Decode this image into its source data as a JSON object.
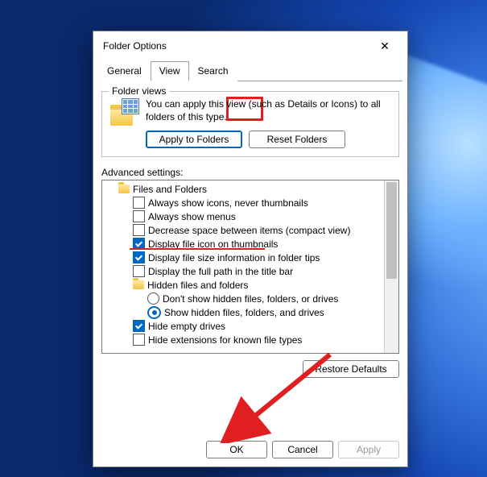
{
  "window": {
    "title": "Folder Options"
  },
  "tabs": [
    "General",
    "View",
    "Search"
  ],
  "active_tab": 1,
  "folder_views": {
    "group_title": "Folder views",
    "description": "You can apply this view (such as Details or Icons) to all folders of this type.",
    "apply_label": "Apply to Folders",
    "reset_label": "Reset Folders"
  },
  "advanced": {
    "label": "Advanced settings:",
    "root": "Files and Folders",
    "items": [
      {
        "type": "check",
        "checked": false,
        "label": "Always show icons, never thumbnails"
      },
      {
        "type": "check",
        "checked": false,
        "label": "Always show menus"
      },
      {
        "type": "check",
        "checked": false,
        "label": "Decrease space between items (compact view)"
      },
      {
        "type": "check",
        "checked": true,
        "label": "Display file icon on thumbnails"
      },
      {
        "type": "check",
        "checked": true,
        "label": "Display file size information in folder tips"
      },
      {
        "type": "check",
        "checked": false,
        "label": "Display the full path in the title bar"
      },
      {
        "type": "folder",
        "label": "Hidden files and folders"
      },
      {
        "type": "radio",
        "selected": false,
        "label": "Don't show hidden files, folders, or drives"
      },
      {
        "type": "radio",
        "selected": true,
        "label": "Show hidden files, folders, and drives"
      },
      {
        "type": "check",
        "checked": true,
        "label": "Hide empty drives"
      },
      {
        "type": "check",
        "checked": false,
        "label": "Hide extensions for known file types"
      }
    ],
    "restore_label": "Restore Defaults"
  },
  "footer": {
    "ok": "OK",
    "cancel": "Cancel",
    "apply": "Apply"
  }
}
